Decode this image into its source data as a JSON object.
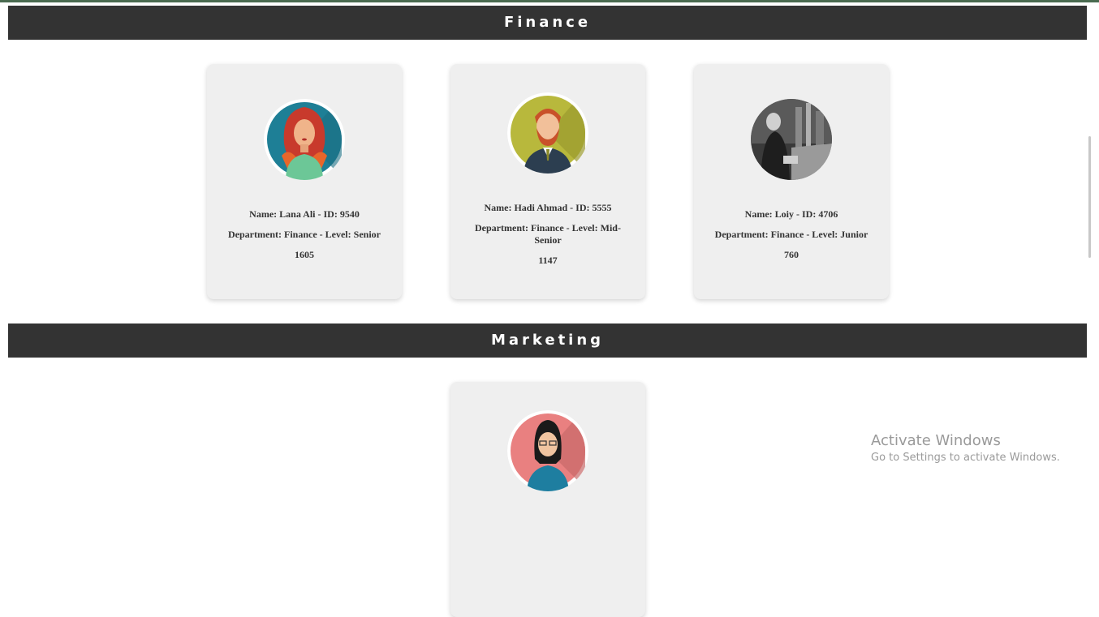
{
  "sections": [
    {
      "title": "Finance",
      "employees": [
        {
          "name_line": "Name: Lana Ali - ID: 9540",
          "department_line": "Department: Finance - Level: Senior",
          "number": "1605",
          "avatar_icon": "woman-red-hair-avatar-icon"
        },
        {
          "name_line": "Name: Hadi Ahmad - ID: 5555",
          "department_line": "Department: Finance - Level: Mid-Senior",
          "number": "1147",
          "avatar_icon": "bearded-man-avatar-icon"
        },
        {
          "name_line": "Name: Loiy - ID: 4706",
          "department_line": "Department: Finance - Level: Junior",
          "number": "760",
          "avatar_icon": "bw-street-photo-avatar"
        }
      ]
    },
    {
      "title": "Marketing",
      "employees": [
        {
          "name_line": "",
          "department_line": "",
          "number": "",
          "avatar_icon": "woman-glasses-avatar-icon"
        }
      ]
    }
  ],
  "watermark": {
    "title": "Activate Windows",
    "subtitle": "Go to Settings to activate Windows."
  },
  "colors": {
    "header_bg": "#333333",
    "card_bg": "#efefef",
    "top_strip": "#4a6b50"
  }
}
